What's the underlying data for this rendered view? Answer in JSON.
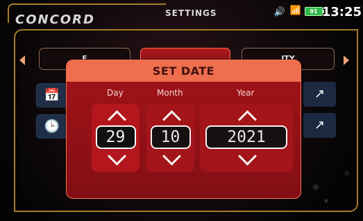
{
  "app": {
    "brand": "CONCORD",
    "screen_title": "SETTINGS",
    "battery": "91",
    "time": "13:25"
  },
  "tabs": [
    {
      "label": "F"
    },
    {
      "label": ""
    },
    {
      "label": "ITY"
    }
  ],
  "icons": {
    "left_nav": "chevron-left-icon",
    "right_nav": "chevron-right-icon",
    "calendar": "calendar-icon",
    "clock": "clock-icon",
    "open": "external-link-icon",
    "volume": "volume-icon",
    "wifi": "wifi-icon"
  },
  "modal": {
    "title": "SET DATE",
    "day_label": "Day",
    "month_label": "Month",
    "year_label": "Year",
    "day_value": "29",
    "month_value": "10",
    "year_value": "2021"
  },
  "colors": {
    "accent": "#ed6f4d",
    "modal": "#9b1217",
    "tab_active": "#b0191f"
  }
}
